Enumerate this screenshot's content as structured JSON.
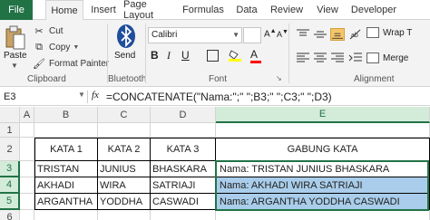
{
  "ribbon_tabs": {
    "file": "File",
    "home": "Home",
    "insert": "Insert",
    "page_layout": "Page Layout",
    "formulas": "Formulas",
    "data": "Data",
    "review": "Review",
    "view": "View",
    "developer": "Developer"
  },
  "clipboard": {
    "paste": "Paste",
    "cut": "Cut",
    "copy": "Copy",
    "format_painter": "Format Painter",
    "group_label": "Clipboard"
  },
  "bluetooth": {
    "send": "Send",
    "group_label": "Bluetooth"
  },
  "font": {
    "name": "Calibri",
    "bold": "B",
    "italic": "I",
    "underline": "U",
    "grow": "A",
    "shrink": "A",
    "font_color_glyph": "A",
    "group_label": "Font"
  },
  "alignment": {
    "wrap_text": "Wrap T",
    "merge": "Merge",
    "group_label": "Alignment"
  },
  "formula_bar": {
    "name_box": "E3",
    "fx": "fx",
    "formula": "=CONCATENATE(\"Nama:\";\" \";B3;\" \";C3;\" \";D3)"
  },
  "columns": [
    "A",
    "B",
    "C",
    "D",
    "E"
  ],
  "rows": [
    "1",
    "2",
    "3",
    "4",
    "5",
    "6"
  ],
  "table": {
    "headers": [
      "KATA 1",
      "KATA 2",
      "KATA 3",
      "GABUNG KATA"
    ],
    "rows": [
      [
        "TRISTAN",
        "JUNIUS",
        "BHASKARA",
        "Nama: TRISTAN JUNIUS BHASKARA"
      ],
      [
        "AKHADI",
        "WIRA",
        "SATRIAJI",
        "Nama: AKHADI WIRA SATRIAJI"
      ],
      [
        "ARGANTHA",
        "YODDHA",
        "CASWADI",
        "Nama: ARGANTHA YODDHA CASWADI"
      ]
    ]
  },
  "colors": {
    "excel_green": "#217346",
    "selection_fill": "#a9cdea"
  }
}
